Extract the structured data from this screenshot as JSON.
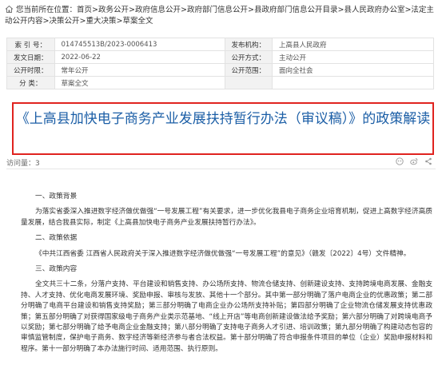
{
  "breadcrumb": {
    "prefix": "您当前所在位置：",
    "items": [
      "首页",
      "政务公开",
      "政府信息公开",
      "政府部门信息公开",
      "县政府部门信息公开目录",
      "县人民政府办公室",
      "法定主动公开内容",
      "决策公开",
      "重大决策",
      "草案全文"
    ],
    "separator": ">"
  },
  "meta": {
    "rows": [
      {
        "k1": "索  引  号：",
        "v1": "014745513B/2023-0006413",
        "k2": "发布机构：",
        "v2": "上高县人民政府"
      },
      {
        "k1": "发文日期：",
        "v1": "2022-06-22",
        "k2": "公开方式：",
        "v2": "主动公开"
      },
      {
        "k1": "公开时限：",
        "v1": "常年公开",
        "k2": "公开范围：",
        "v2": "面向全社会"
      },
      {
        "k1": "分    类：",
        "v1": "草案全文",
        "k2": "",
        "v2": ""
      }
    ]
  },
  "title": "《上高县加快电子商务产业发展扶持暂行办法（审议稿）》的政策解读",
  "views": {
    "label": "访问量：",
    "count": "3"
  },
  "content": [
    {
      "type": "h",
      "text": "一、政策背景"
    },
    {
      "type": "p",
      "text": "为落实省委深入推进数字经济做优做强“一号发展工程”有关要求，进一步优化我县电子商务企业培育机制，促进上高数字经济高质量发展，结合我县实际，制定《上高县加快电子商务产业发展扶持暂行办法》。"
    },
    {
      "type": "h",
      "text": "二、政策依据"
    },
    {
      "type": "p",
      "text": "《中共江西省委 江西省人民政府关于深入推进数字经济做优做强“一号发展工程”的意见》（赣发〔2022〕4号）文件精神。"
    },
    {
      "type": "h",
      "text": "三、政策内容"
    },
    {
      "type": "p",
      "text": "全文共三十二条，分落户支持、平台建设和销售支持、办公场所支持、物流仓储支持、创新建设支持、支持跨境电商发展、金融支持、人才支持、优化电商发展环境、奖励申报、审核与发放、其他十一个部分。其中第一部分明确了落户电商企业的优惠政策；第二部分明确了电商平台建设和销售支持奖励；第三部分明确了电商企业办公场所支持补贴；第四部分明确了企业物流仓储发展支持优惠政策；第五部分明确了对获得国家级电子商务产业类示范基地、“线上开店”等电商创新建设做法给予奖励；第六部分明确了对跨境电商予以奖励；第七部分明确了给予电商企业金融支持；第八部分明确了支持电子商务人才引进、培训政策；第九部分明确了构建动态包容的审慎监管制度，保护电子商务、数字经济等新经济参与者合法权益。第十部分明确了符合申报条件项目的单位（企业）奖励申报材料和程序。第十一部分明确了本办法施行时间、适用范围、执行原则。"
    }
  ],
  "colors": {
    "title": "#1b5ea6",
    "title_border": "#e0231f"
  }
}
